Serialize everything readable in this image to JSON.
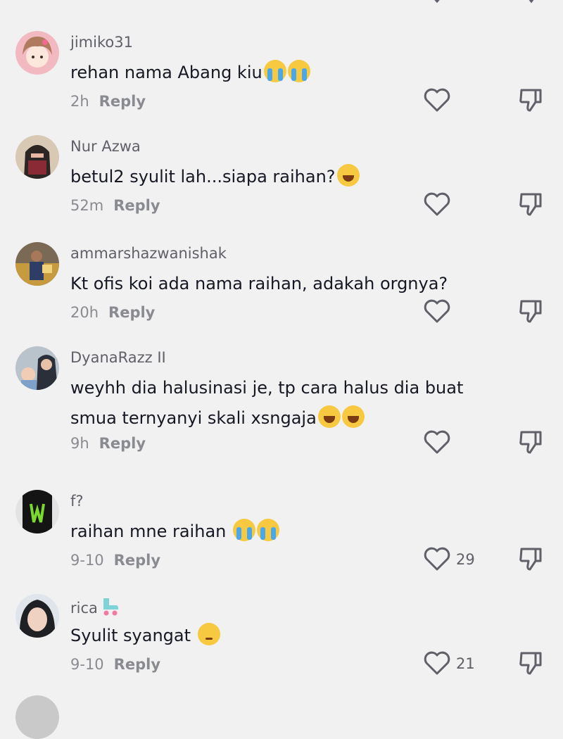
{
  "comments": [
    {
      "username": "jimiko31",
      "text": "rehan nama Abang kiu",
      "emojis": [
        "crying-emoji",
        "crying-emoji"
      ],
      "time": "2h",
      "reply": "Reply",
      "likes": ""
    },
    {
      "username": "Nur Azwa",
      "text": "betul2 syulit lah...siapa raihan?",
      "emojis": [
        "grinning-squint-emoji"
      ],
      "time": "52m",
      "reply": "Reply",
      "likes": ""
    },
    {
      "username": "ammarshazwanishak",
      "text": "Kt ofis koi ada nama raihan, adakah orgnya?",
      "emojis": [],
      "time": "20h",
      "reply": "Reply",
      "likes": ""
    },
    {
      "username": "DyanaRazz II",
      "text_line1": "weyhh dia halusinasi je, tp cara halus dia buat",
      "text_line2": "smua ternyanyi skali xsngaja",
      "emojis": [
        "tears-of-joy-emoji",
        "tears-of-joy-emoji"
      ],
      "time": "9h",
      "reply": "Reply",
      "likes": ""
    },
    {
      "username": "f?",
      "text": "raihan mne raihan",
      "emojis": [
        "crying-emoji",
        "crying-emoji"
      ],
      "time": "9-10",
      "reply": "Reply",
      "likes": "29"
    },
    {
      "username": "rica",
      "username_icon": "roller-skate-emoji",
      "text": "Syulit syangat",
      "emojis": [
        "pensive-emoji"
      ],
      "time": "9-10",
      "reply": "Reply",
      "likes": "21"
    }
  ],
  "colors": {
    "background": "#f1f1f2",
    "text": "#161823",
    "muted": "#8a8b91",
    "icon": "#5f6068"
  }
}
